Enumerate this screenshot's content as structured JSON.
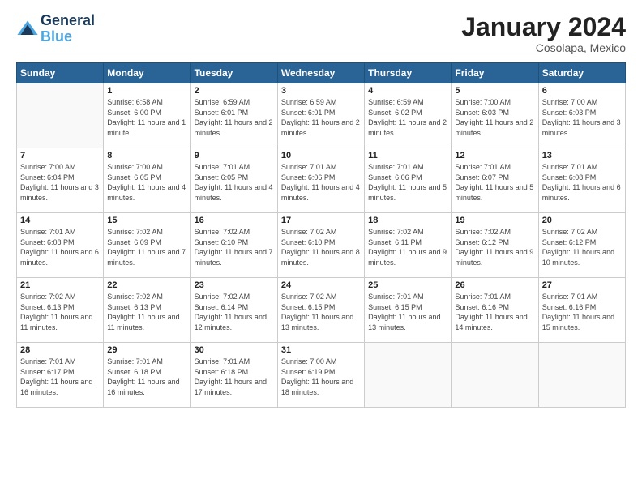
{
  "header": {
    "logo_line1": "General",
    "logo_line2": "Blue",
    "month_title": "January 2024",
    "location": "Cosolapa, Mexico"
  },
  "weekdays": [
    "Sunday",
    "Monday",
    "Tuesday",
    "Wednesday",
    "Thursday",
    "Friday",
    "Saturday"
  ],
  "weeks": [
    [
      {
        "day": "",
        "sunrise": "",
        "sunset": "",
        "daylight": ""
      },
      {
        "day": "1",
        "sunrise": "Sunrise: 6:58 AM",
        "sunset": "Sunset: 6:00 PM",
        "daylight": "Daylight: 11 hours and 1 minute."
      },
      {
        "day": "2",
        "sunrise": "Sunrise: 6:59 AM",
        "sunset": "Sunset: 6:01 PM",
        "daylight": "Daylight: 11 hours and 2 minutes."
      },
      {
        "day": "3",
        "sunrise": "Sunrise: 6:59 AM",
        "sunset": "Sunset: 6:01 PM",
        "daylight": "Daylight: 11 hours and 2 minutes."
      },
      {
        "day": "4",
        "sunrise": "Sunrise: 6:59 AM",
        "sunset": "Sunset: 6:02 PM",
        "daylight": "Daylight: 11 hours and 2 minutes."
      },
      {
        "day": "5",
        "sunrise": "Sunrise: 7:00 AM",
        "sunset": "Sunset: 6:03 PM",
        "daylight": "Daylight: 11 hours and 2 minutes."
      },
      {
        "day": "6",
        "sunrise": "Sunrise: 7:00 AM",
        "sunset": "Sunset: 6:03 PM",
        "daylight": "Daylight: 11 hours and 3 minutes."
      }
    ],
    [
      {
        "day": "7",
        "sunrise": "Sunrise: 7:00 AM",
        "sunset": "Sunset: 6:04 PM",
        "daylight": "Daylight: 11 hours and 3 minutes."
      },
      {
        "day": "8",
        "sunrise": "Sunrise: 7:00 AM",
        "sunset": "Sunset: 6:05 PM",
        "daylight": "Daylight: 11 hours and 4 minutes."
      },
      {
        "day": "9",
        "sunrise": "Sunrise: 7:01 AM",
        "sunset": "Sunset: 6:05 PM",
        "daylight": "Daylight: 11 hours and 4 minutes."
      },
      {
        "day": "10",
        "sunrise": "Sunrise: 7:01 AM",
        "sunset": "Sunset: 6:06 PM",
        "daylight": "Daylight: 11 hours and 4 minutes."
      },
      {
        "day": "11",
        "sunrise": "Sunrise: 7:01 AM",
        "sunset": "Sunset: 6:06 PM",
        "daylight": "Daylight: 11 hours and 5 minutes."
      },
      {
        "day": "12",
        "sunrise": "Sunrise: 7:01 AM",
        "sunset": "Sunset: 6:07 PM",
        "daylight": "Daylight: 11 hours and 5 minutes."
      },
      {
        "day": "13",
        "sunrise": "Sunrise: 7:01 AM",
        "sunset": "Sunset: 6:08 PM",
        "daylight": "Daylight: 11 hours and 6 minutes."
      }
    ],
    [
      {
        "day": "14",
        "sunrise": "Sunrise: 7:01 AM",
        "sunset": "Sunset: 6:08 PM",
        "daylight": "Daylight: 11 hours and 6 minutes."
      },
      {
        "day": "15",
        "sunrise": "Sunrise: 7:02 AM",
        "sunset": "Sunset: 6:09 PM",
        "daylight": "Daylight: 11 hours and 7 minutes."
      },
      {
        "day": "16",
        "sunrise": "Sunrise: 7:02 AM",
        "sunset": "Sunset: 6:10 PM",
        "daylight": "Daylight: 11 hours and 7 minutes."
      },
      {
        "day": "17",
        "sunrise": "Sunrise: 7:02 AM",
        "sunset": "Sunset: 6:10 PM",
        "daylight": "Daylight: 11 hours and 8 minutes."
      },
      {
        "day": "18",
        "sunrise": "Sunrise: 7:02 AM",
        "sunset": "Sunset: 6:11 PM",
        "daylight": "Daylight: 11 hours and 9 minutes."
      },
      {
        "day": "19",
        "sunrise": "Sunrise: 7:02 AM",
        "sunset": "Sunset: 6:12 PM",
        "daylight": "Daylight: 11 hours and 9 minutes."
      },
      {
        "day": "20",
        "sunrise": "Sunrise: 7:02 AM",
        "sunset": "Sunset: 6:12 PM",
        "daylight": "Daylight: 11 hours and 10 minutes."
      }
    ],
    [
      {
        "day": "21",
        "sunrise": "Sunrise: 7:02 AM",
        "sunset": "Sunset: 6:13 PM",
        "daylight": "Daylight: 11 hours and 11 minutes."
      },
      {
        "day": "22",
        "sunrise": "Sunrise: 7:02 AM",
        "sunset": "Sunset: 6:13 PM",
        "daylight": "Daylight: 11 hours and 11 minutes."
      },
      {
        "day": "23",
        "sunrise": "Sunrise: 7:02 AM",
        "sunset": "Sunset: 6:14 PM",
        "daylight": "Daylight: 11 hours and 12 minutes."
      },
      {
        "day": "24",
        "sunrise": "Sunrise: 7:02 AM",
        "sunset": "Sunset: 6:15 PM",
        "daylight": "Daylight: 11 hours and 13 minutes."
      },
      {
        "day": "25",
        "sunrise": "Sunrise: 7:01 AM",
        "sunset": "Sunset: 6:15 PM",
        "daylight": "Daylight: 11 hours and 13 minutes."
      },
      {
        "day": "26",
        "sunrise": "Sunrise: 7:01 AM",
        "sunset": "Sunset: 6:16 PM",
        "daylight": "Daylight: 11 hours and 14 minutes."
      },
      {
        "day": "27",
        "sunrise": "Sunrise: 7:01 AM",
        "sunset": "Sunset: 6:16 PM",
        "daylight": "Daylight: 11 hours and 15 minutes."
      }
    ],
    [
      {
        "day": "28",
        "sunrise": "Sunrise: 7:01 AM",
        "sunset": "Sunset: 6:17 PM",
        "daylight": "Daylight: 11 hours and 16 minutes."
      },
      {
        "day": "29",
        "sunrise": "Sunrise: 7:01 AM",
        "sunset": "Sunset: 6:18 PM",
        "daylight": "Daylight: 11 hours and 16 minutes."
      },
      {
        "day": "30",
        "sunrise": "Sunrise: 7:01 AM",
        "sunset": "Sunset: 6:18 PM",
        "daylight": "Daylight: 11 hours and 17 minutes."
      },
      {
        "day": "31",
        "sunrise": "Sunrise: 7:00 AM",
        "sunset": "Sunset: 6:19 PM",
        "daylight": "Daylight: 11 hours and 18 minutes."
      },
      {
        "day": "",
        "sunrise": "",
        "sunset": "",
        "daylight": ""
      },
      {
        "day": "",
        "sunrise": "",
        "sunset": "",
        "daylight": ""
      },
      {
        "day": "",
        "sunrise": "",
        "sunset": "",
        "daylight": ""
      }
    ]
  ]
}
